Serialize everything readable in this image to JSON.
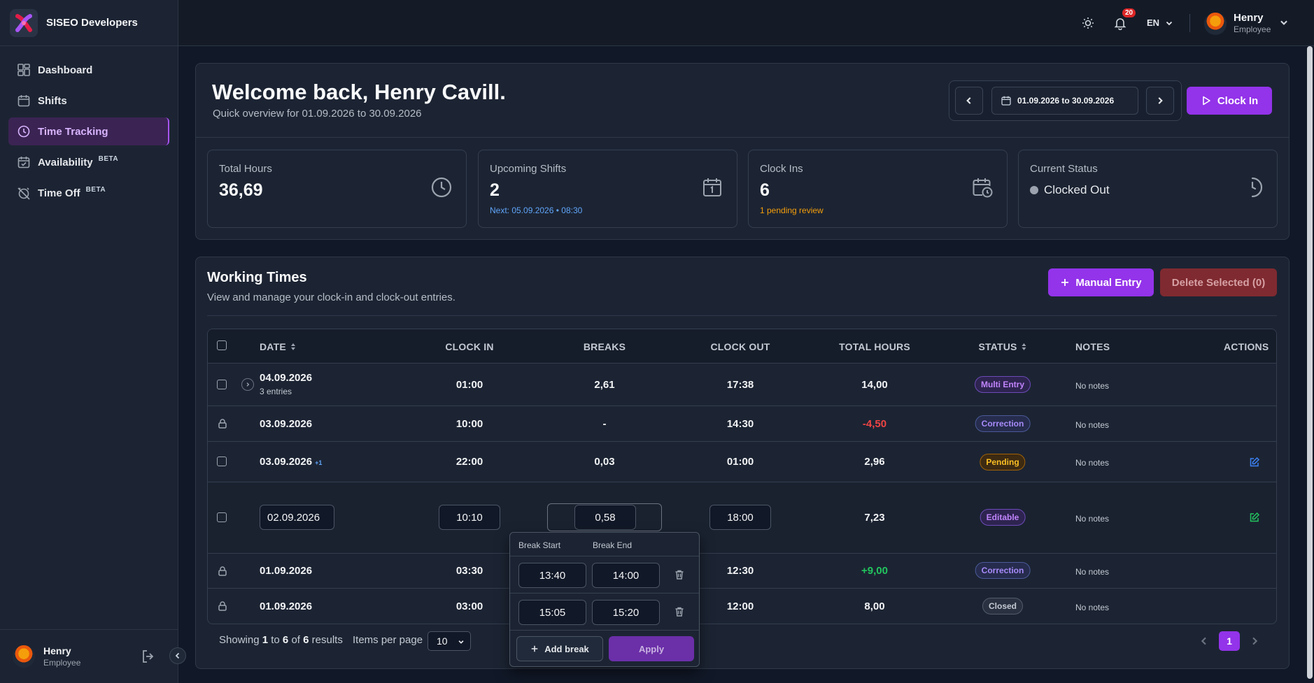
{
  "app": {
    "name": "SISEO Developers"
  },
  "sidebar": {
    "items": [
      {
        "label": "Dashboard",
        "icon": "grid-icon"
      },
      {
        "label": "Shifts",
        "icon": "calendar-icon"
      },
      {
        "label": "Time Tracking",
        "icon": "clock-icon",
        "active": true
      },
      {
        "label": "Availability",
        "icon": "calendar-check-icon",
        "badge": "BETA"
      },
      {
        "label": "Time Off",
        "icon": "alarm-off-icon",
        "badge": "BETA"
      }
    ],
    "user": {
      "name": "Henry",
      "role": "Employee"
    }
  },
  "topbar": {
    "notifications_count": "20",
    "language": "EN",
    "user": {
      "name": "Henry",
      "role": "Employee"
    }
  },
  "welcome": {
    "title": "Welcome back, Henry Cavill.",
    "subtitle": "Quick overview for 01.09.2026 to 30.09.2026",
    "date_range": "01.09.2026 to 30.09.2026",
    "clock_in_label": "Clock In"
  },
  "stats": {
    "total_hours": {
      "label": "Total Hours",
      "value": "36,69"
    },
    "upcoming_shifts": {
      "label": "Upcoming Shifts",
      "value": "2",
      "sub": "Next: 05.09.2026 • 08:30"
    },
    "clock_ins": {
      "label": "Clock Ins",
      "value": "6",
      "sub": "1 pending review"
    },
    "current_status": {
      "label": "Current Status",
      "value": "Clocked Out"
    }
  },
  "working_times": {
    "title": "Working Times",
    "subtitle": "View and manage your clock-in and clock-out entries.",
    "manual_entry_label": "Manual Entry",
    "delete_selected_label": "Delete Selected (0)",
    "columns": {
      "date": "DATE",
      "clock_in": "CLOCK IN",
      "breaks": "BREAKS",
      "clock_out": "CLOCK OUT",
      "total_hours": "TOTAL HOURS",
      "status": "STATUS",
      "notes": "NOTES",
      "actions": "ACTIONS"
    },
    "rows": [
      {
        "date": "04.09.2026",
        "sub": "3 entries",
        "clock_in": "01:00",
        "breaks": "2,61",
        "clock_out": "17:38",
        "total": "14,00",
        "status": "Multi Entry",
        "notes": "No notes"
      },
      {
        "date": "03.09.2026",
        "clock_in": "10:00",
        "breaks": "-",
        "clock_out": "14:30",
        "total": "-4,50",
        "status": "Correction",
        "notes": "No notes"
      },
      {
        "date": "03.09.2026",
        "extra": "+1",
        "clock_in": "22:00",
        "breaks": "0,03",
        "clock_out": "01:00",
        "total": "2,96",
        "status": "Pending",
        "notes": "No notes"
      },
      {
        "date": "02.09.2026",
        "clock_in": "10:10",
        "breaks": "0,58",
        "clock_out": "18:00",
        "total": "7,23",
        "status": "Editable",
        "notes": "No notes"
      },
      {
        "date": "01.09.2026",
        "clock_in": "03:30",
        "breaks": "",
        "clock_out": "12:30",
        "total": "+9,00",
        "status": "Correction",
        "notes": "No notes"
      },
      {
        "date": "01.09.2026",
        "clock_in": "03:00",
        "breaks": "",
        "clock_out": "12:00",
        "total": "8,00",
        "status": "Closed",
        "notes": "No notes"
      }
    ],
    "footer": {
      "showing_prefix": "Showing",
      "from": "1",
      "to_word": "to",
      "to": "6",
      "of_word": "of",
      "total": "6",
      "results_word": "results",
      "items_per_page_label": "Items per page",
      "items_per_page": "10",
      "current_page": "1"
    }
  },
  "break_popover": {
    "break_start_label": "Break Start",
    "break_end_label": "Break End",
    "breaks": [
      {
        "start": "13:40",
        "end": "14:00"
      },
      {
        "start": "15:05",
        "end": "15:20"
      }
    ],
    "add_break_label": "Add break",
    "apply_label": "Apply"
  },
  "colors": {
    "accent": "#9333ea",
    "positive": "#22c55e",
    "negative": "#ef4444",
    "info": "#60a5fa",
    "warning": "#f59e0b"
  }
}
